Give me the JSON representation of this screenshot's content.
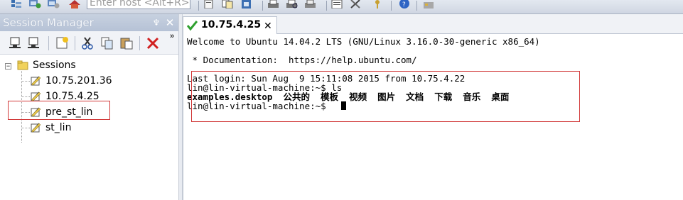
{
  "toolbar": {
    "host_placeholder": "Enter host <Alt+R>",
    "icons": [
      "session-tree-icon",
      "reconnect-icon",
      "disconnect-icon",
      "home-icon",
      "new-session-icon",
      "copy-icon",
      "paste-icon",
      "find-icon",
      "print-icon",
      "print-preview-icon",
      "print-setup-icon",
      "properties-icon",
      "tools-icon",
      "keymap-icon",
      "help-icon",
      "lock-icon"
    ]
  },
  "session_manager": {
    "title": "Session Manager",
    "pin_glyph": "♆",
    "close_glyph": "✕",
    "overflow_glyph": "»",
    "tree": {
      "root_label": "Sessions",
      "items": [
        {
          "label": "10.75.201.36",
          "selected": false
        },
        {
          "label": "10.75.4.25",
          "selected": true
        },
        {
          "label": "pre_st_lin",
          "selected": false
        },
        {
          "label": "st_lin",
          "selected": false
        }
      ]
    }
  },
  "tab": {
    "label": "10.75.4.25",
    "close_glyph": "✕"
  },
  "terminal": {
    "lines": [
      "Welcome to Ubuntu 14.04.2 LTS (GNU/Linux 3.16.0-30-generic x86_64)",
      "",
      " * Documentation:  https://help.ubuntu.com/",
      "",
      "Last login: Sun Aug  9 15:11:08 2015 from 10.75.4.22",
      "lin@lin-virtual-machine:~$ ls",
      "examples.desktop  公共的  模板  视频  图片  文档  下载  音乐  桌面",
      "lin@lin-virtual-machine:~$ "
    ]
  },
  "colors": {
    "highlight_border": "#d23a3a",
    "panel_header": "#b6c2d6"
  }
}
